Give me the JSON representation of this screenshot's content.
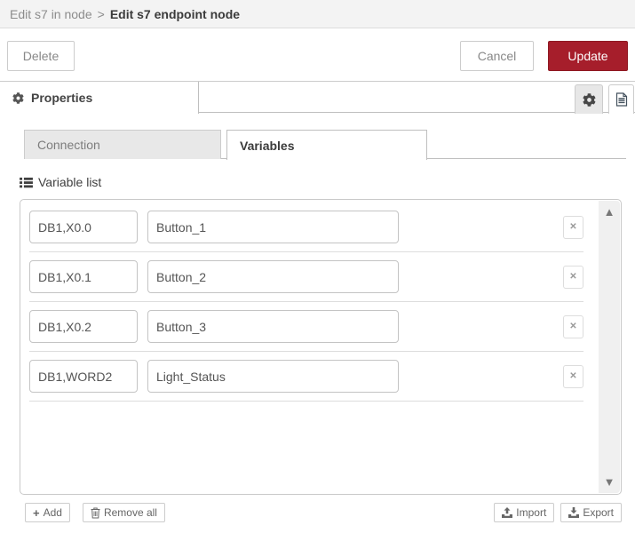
{
  "window": {
    "breadcrumb": {
      "parent": "Edit s7 in node",
      "separator": ">",
      "current": "Edit s7 endpoint node"
    }
  },
  "toolbar": {
    "delete_label": "Delete",
    "cancel_label": "Cancel",
    "update_label": "Update"
  },
  "editor_tabs": {
    "properties_label": "Properties",
    "properties_icon": "gear-icon",
    "settings_icon": "gear-icon",
    "description_icon": "file-document-icon"
  },
  "node_tabs": {
    "connection_label": "Connection",
    "variables_label": "Variables"
  },
  "variables_panel": {
    "list_label": "Variable list",
    "list_icon": "list-icon",
    "rows": [
      {
        "address": "DB1,X0.0",
        "name": "Button_1"
      },
      {
        "address": "DB1,X0.1",
        "name": "Button_2"
      },
      {
        "address": "DB1,X0.2",
        "name": "Button_3"
      },
      {
        "address": "DB1,WORD2",
        "name": "Light_Status"
      }
    ],
    "remove_row_glyph": "✕",
    "scroll_up_glyph": "▲",
    "scroll_down_glyph": "▼",
    "footer": {
      "add_glyph": "+",
      "add_label": "Add",
      "remove_all_label": "Remove all",
      "import_label": "Import",
      "export_label": "Export"
    }
  },
  "colors": {
    "accent_red": "#A61E2B",
    "header_bg": "#f3f3f3",
    "border_grey": "#cccccc",
    "inactive_tab_bg": "#e8e8e8"
  }
}
